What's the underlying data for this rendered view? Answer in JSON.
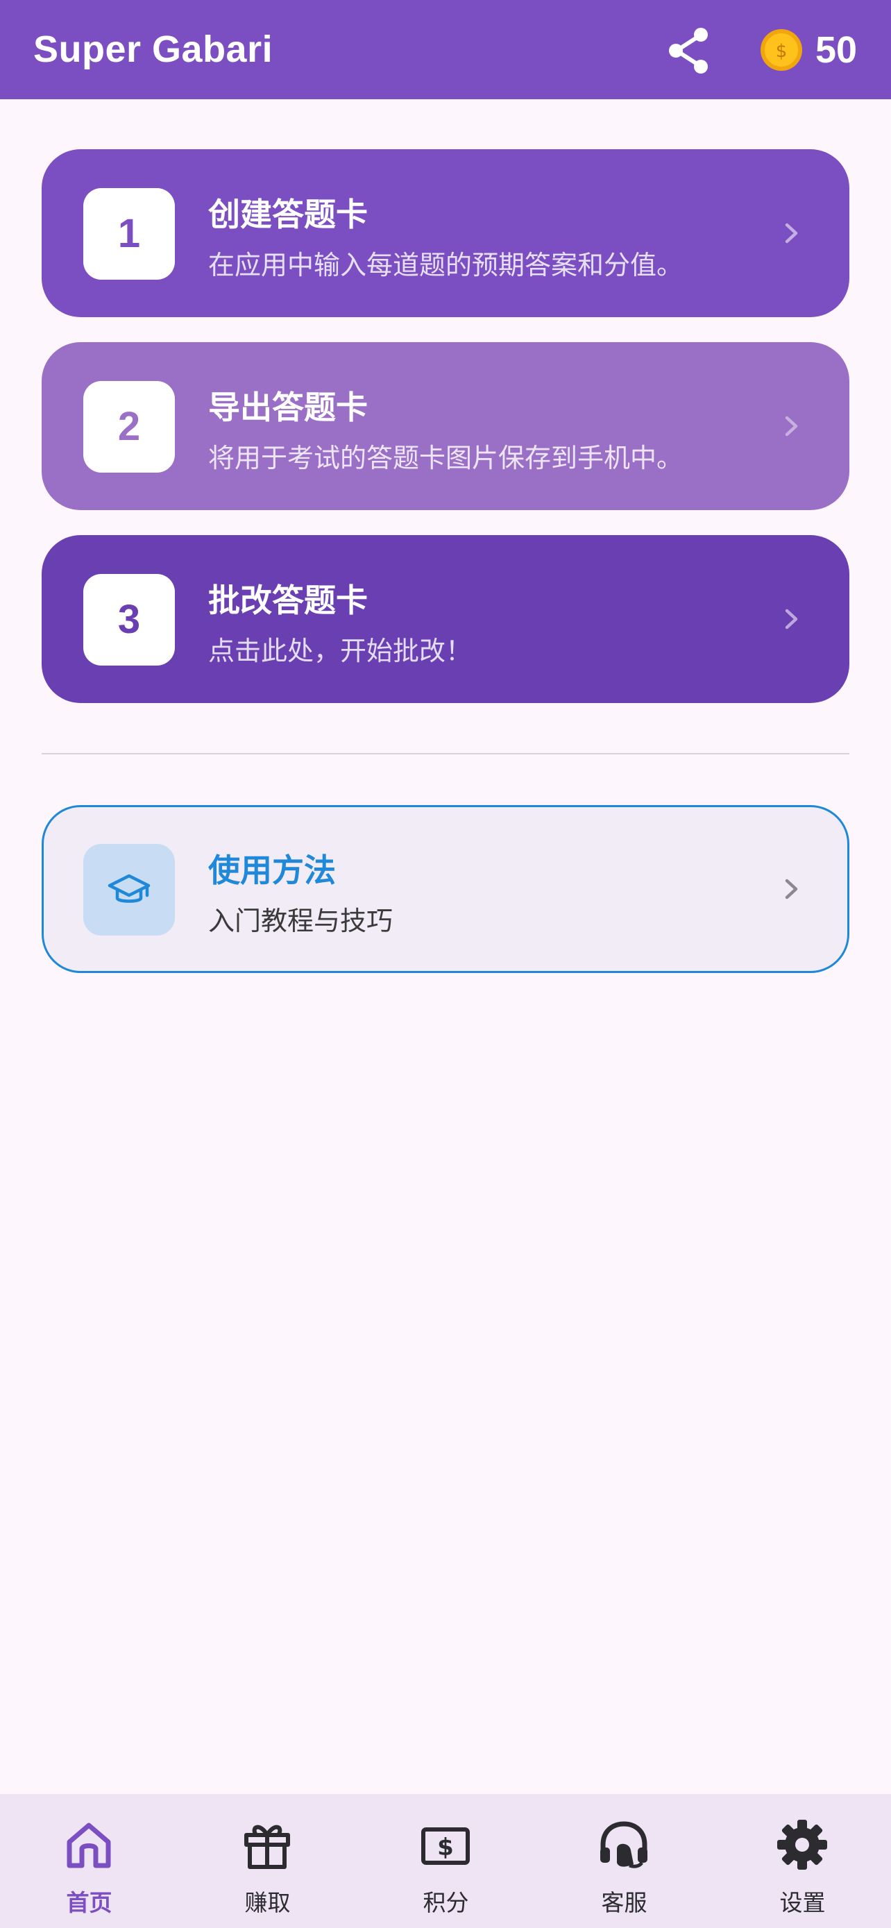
{
  "appbar": {
    "title": "Super Gabari",
    "share_icon": "share-icon",
    "coin_icon": "dollar-coin-icon",
    "coin_count": "50",
    "background_color": "#7b4fc1"
  },
  "steps": [
    {
      "number": "1",
      "title": "创建答题卡",
      "subtitle": "在应用中输入每道题的预期答案和分值。",
      "color": "#7b4fc1"
    },
    {
      "number": "2",
      "title": "导出答题卡",
      "subtitle": "将用于考试的答题卡图片保存到手机中。",
      "color": "#9a6fc6"
    },
    {
      "number": "3",
      "title": "批改答题卡",
      "subtitle": "点击此处，开始批改！",
      "color": "#6a3fb2"
    }
  ],
  "help": {
    "icon": "graduation-cap-icon",
    "title": "使用方法",
    "subtitle": "入门教程与技巧",
    "accent_color": "#1f88d8"
  },
  "bottom_nav": {
    "items": [
      {
        "label": "首页",
        "icon": "home-icon",
        "active": true
      },
      {
        "label": "赚取",
        "icon": "gift-icon",
        "active": false
      },
      {
        "label": "积分",
        "icon": "dollar-bill-icon",
        "active": false
      },
      {
        "label": "客服",
        "icon": "headset-icon",
        "active": false
      },
      {
        "label": "设置",
        "icon": "gear-icon",
        "active": false
      }
    ]
  }
}
